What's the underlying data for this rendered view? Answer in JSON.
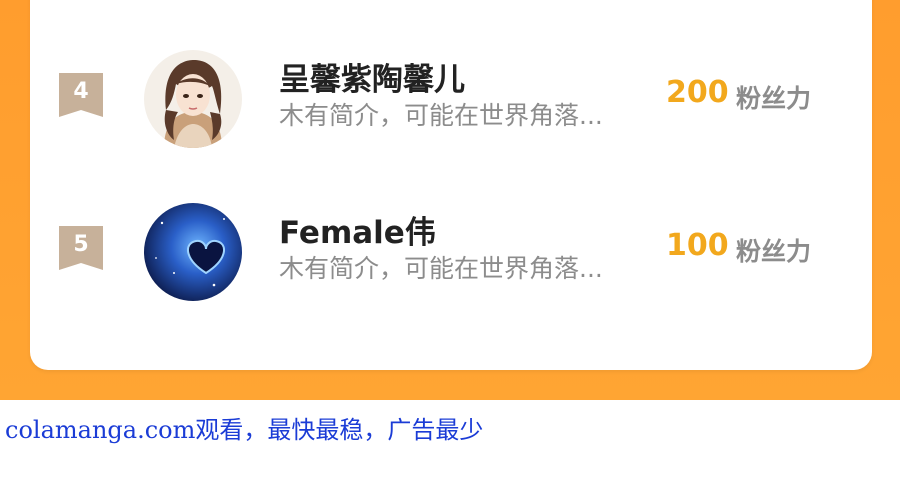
{
  "leaderboard": {
    "rows": [
      {
        "rank": "4",
        "name": "呈馨紫陶馨儿",
        "bio": "木有简介，可能在世界角落...",
        "score": "200",
        "score_unit": "粉丝力",
        "avatar": "girl-portrait-icon"
      },
      {
        "rank": "5",
        "name": "Female伟",
        "bio": "木有简介，可能在世界角落...",
        "score": "100",
        "score_unit": "粉丝力",
        "avatar": "blue-heart-galaxy-icon"
      }
    ]
  },
  "watermark": {
    "text": "colamanga.com观看，最快最稳，广告最少"
  },
  "colors": {
    "background_orange": "#ffa533",
    "score_gold": "#f2a81d",
    "rank_badge": "#c7b19a",
    "watermark_blue": "#1b3cd6"
  }
}
